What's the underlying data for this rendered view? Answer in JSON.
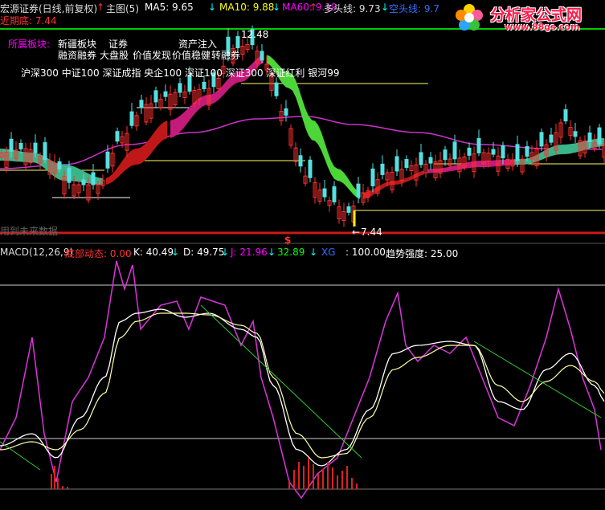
{
  "header": {
    "stock_name": "宏源证券(日线,前复权)",
    "main_label": "主图(5)",
    "ma5_label": "MA5: 9.65",
    "ma10_label": "MA10: 9.88",
    "ma60_label": "MA60: 9.19",
    "duo_label": "多头线: 9.73",
    "kong_label": "空头线: 9.7",
    "recent_low": "近期底: 7.44",
    "high_marker": "12.48",
    "low_marker": "7.44",
    "future_data": "用到未来数据",
    "dollar_mark": "$"
  },
  "sectors": {
    "title": "所属板块:",
    "line1": [
      "新疆板块",
      "证券",
      "资产注入"
    ],
    "line2": [
      "融资融券",
      "大盘股",
      "价值发现",
      "价值稳健",
      "转融券"
    ],
    "line3": "沪深300 中证100 深证成指 央企100 深证100 深证300 深证红利 银河99"
  },
  "indicator": {
    "macd_label": "MACD(12,26,9)",
    "bottom_label": "底部动态: 0.00",
    "k_label": "K: 40.49",
    "d_label": "D: 49.75",
    "j_label": "J: 21.96",
    "v_label": "32.89",
    "xg_label": "XG",
    "val100": ": 100.00",
    "trend_label": "趋势强度: 25.00"
  },
  "watermark": {
    "site_name": "分析家公式网",
    "site_url": "www.88gs.com"
  },
  "colors": {
    "bg": "#000000",
    "red": "#ff3030",
    "cyan": "#00ffff",
    "white": "#ffffff",
    "magenta": "#ff00ff",
    "yellow": "#ffff00",
    "green": "#00ff00",
    "orange": "#ff8800"
  }
}
